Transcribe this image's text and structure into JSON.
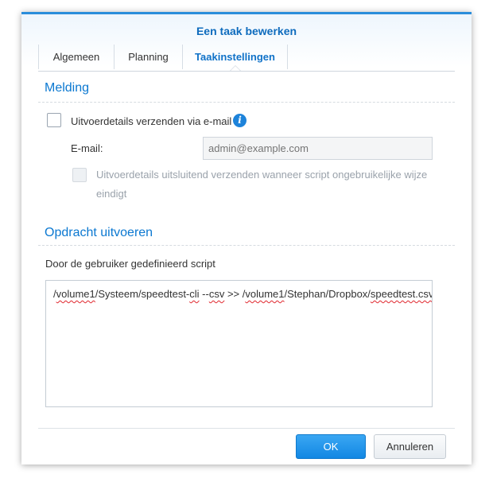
{
  "dialog": {
    "title": "Een taak bewerken"
  },
  "tabs": [
    {
      "label": "Algemeen"
    },
    {
      "label": "Planning"
    },
    {
      "label": "Taakinstellingen"
    }
  ],
  "notification": {
    "section_title": "Melding",
    "send_details_label": "Uitvoerdetails verzenden via e-mail",
    "send_details_checked": false,
    "email_label": "E-mail:",
    "email_placeholder": "admin@example.com",
    "email_value": "",
    "abnormal_only_line1": "Uitvoerdetails uitsluitend verzenden wanneer script ongebruikelijke wijze",
    "abnormal_only_line2": "eindigt",
    "abnormal_only_checked": false
  },
  "run_command": {
    "section_title": "Opdracht uitvoeren",
    "script_label": "Door de gebruiker gedefinieerd script",
    "script_parts": [
      {
        "text": "/",
        "misspelled": false
      },
      {
        "text": "volume1",
        "misspelled": true
      },
      {
        "text": "/Systeem/speedtest-",
        "misspelled": false
      },
      {
        "text": "cli",
        "misspelled": true
      },
      {
        "text": " --",
        "misspelled": false
      },
      {
        "text": "csv",
        "misspelled": true
      },
      {
        "text": " >> /",
        "misspelled": false
      },
      {
        "text": "volume1",
        "misspelled": true
      },
      {
        "text": "/Stephan/Dropbox/",
        "misspelled": false
      },
      {
        "text": "speedtest.csv",
        "misspelled": true
      }
    ]
  },
  "footer": {
    "ok_label": "OK",
    "cancel_label": "Annuleren"
  },
  "colors": {
    "accent": "#0b78d1",
    "primary_button": "#1a8ee6",
    "spellcheck": "#e0262d"
  },
  "icons": {
    "info": "info-icon"
  }
}
